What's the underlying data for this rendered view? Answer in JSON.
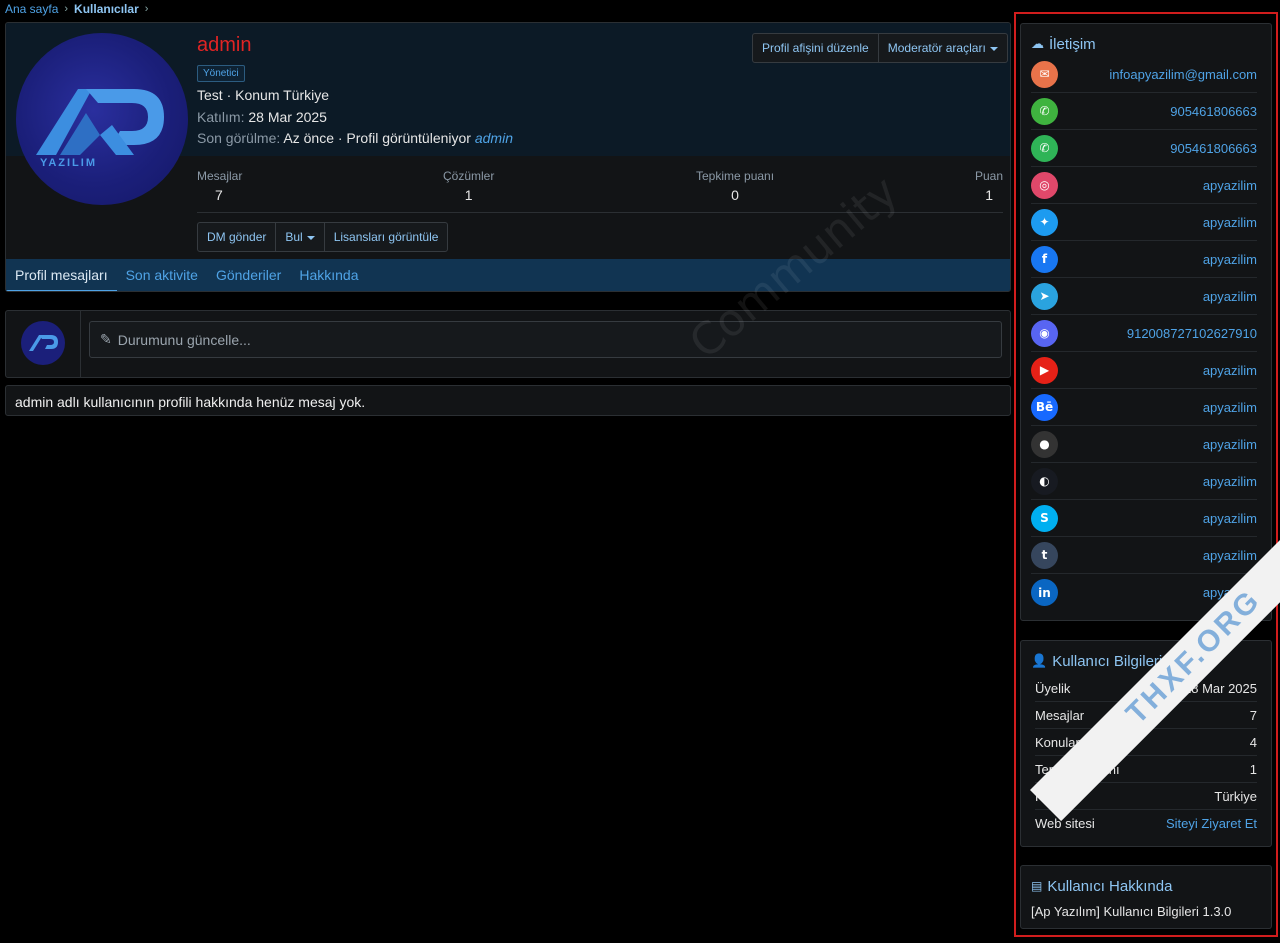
{
  "breadcrumb": {
    "home": "Ana sayfa",
    "current": "Kullanıcılar"
  },
  "profile": {
    "username": "admin",
    "role": "Yönetici",
    "title_location": "Test · Konum Türkiye",
    "joined_label": "Katılım:",
    "joined_value": "28 Mar 2025",
    "last_seen_label": "Son görülme:",
    "last_seen_value": "Az önce · Profil görüntüleniyor",
    "last_seen_link": "admin",
    "edit_banner_label": "Profil afişini düzenle",
    "moderator_tools_label": "Moderatör araçları",
    "stats": [
      {
        "label": "Mesajlar",
        "value": "7"
      },
      {
        "label": "Çözümler",
        "value": "1"
      },
      {
        "label": "Tepkime puanı",
        "value": "0"
      },
      {
        "label": "Puan",
        "value": "1"
      }
    ],
    "actions": {
      "dm": "DM gönder",
      "find": "Bul",
      "licenses": "Lisansları görüntüle"
    },
    "tabs": [
      "Profil mesajları",
      "Son aktivite",
      "Gönderiler",
      "Hakkında"
    ],
    "avatar_text": "YAZILIM"
  },
  "status": {
    "placeholder": "Durumunu güncelle..."
  },
  "empty_message": "admin adlı kullanıcının profili hakkında henüz mesaj yok.",
  "watermark": "Community",
  "contact": {
    "title": "İletişim",
    "items": [
      {
        "icon": "email-icon",
        "glyph": "✉",
        "color": "#e8734a",
        "value": "infoapyazilim@gmail.com"
      },
      {
        "icon": "phone-icon",
        "glyph": "✆",
        "color": "#3fb33f",
        "value": "905461806663"
      },
      {
        "icon": "whatsapp-icon",
        "glyph": "✆",
        "color": "#2fb457",
        "value": "905461806663"
      },
      {
        "icon": "instagram-icon",
        "glyph": "◎",
        "color": "#e0486a",
        "value": "apyazilim"
      },
      {
        "icon": "twitter-icon",
        "glyph": "✦",
        "color": "#1d9bf0",
        "value": "apyazilim"
      },
      {
        "icon": "facebook-icon",
        "glyph": "f",
        "color": "#1877f2",
        "value": "apyazilim"
      },
      {
        "icon": "telegram-icon",
        "glyph": "➤",
        "color": "#2aa3df",
        "value": "apyazilim"
      },
      {
        "icon": "discord-icon",
        "glyph": "◉",
        "color": "#5865f2",
        "value": "912008727102627910"
      },
      {
        "icon": "youtube-icon",
        "glyph": "▶",
        "color": "#e62117",
        "value": "apyazilim"
      },
      {
        "icon": "behance-icon",
        "glyph": "Bē",
        "color": "#1769ff",
        "value": "apyazilim"
      },
      {
        "icon": "github-icon",
        "glyph": "●",
        "color": "#333333",
        "value": "apyazilim"
      },
      {
        "icon": "steam-icon",
        "glyph": "◐",
        "color": "#171a21",
        "value": "apyazilim"
      },
      {
        "icon": "skype-icon",
        "glyph": "S",
        "color": "#00aff0",
        "value": "apyazilim"
      },
      {
        "icon": "tumblr-icon",
        "glyph": "t",
        "color": "#36465d",
        "value": "apyazilim"
      },
      {
        "icon": "linkedin-icon",
        "glyph": "in",
        "color": "#0a66c2",
        "value": "apyazilim"
      }
    ]
  },
  "user_info": {
    "title": "Kullanıcı Bilgileri",
    "rows": [
      {
        "label": "Üyelik",
        "value": "28 Mar 2025"
      },
      {
        "label": "Mesajlar",
        "value": "7"
      },
      {
        "label": "Konular",
        "value": "4"
      },
      {
        "label": "Tepkime puanı",
        "value": "1"
      },
      {
        "label": "Konum",
        "value": "Türkiye"
      },
      {
        "label": "Web sitesi",
        "value": "Siteyi Ziyaret Et"
      }
    ]
  },
  "about": {
    "title": "Kullanıcı Hakkında",
    "text": "[Ap Yazılım] Kullanıcı Bilgileri 1.3.0"
  },
  "ribbon_text": "THXF.ORG",
  "colors": {
    "accent": "#4fa3e6",
    "username": "#e02424",
    "highlight_frame": "#d11d1d"
  }
}
